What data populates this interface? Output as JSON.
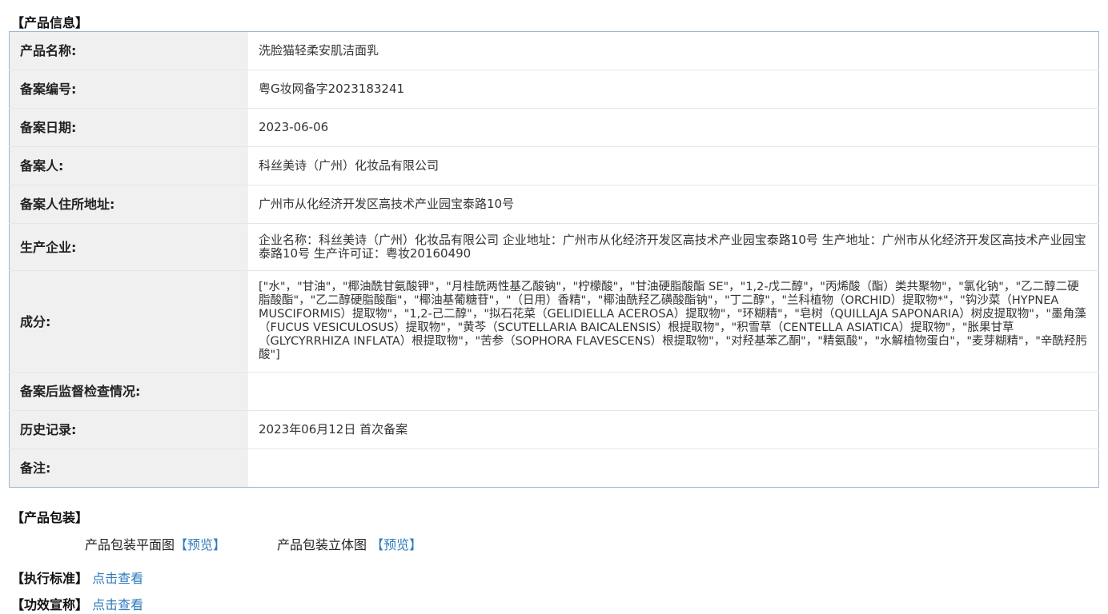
{
  "product_info": {
    "title": "【产品信息】",
    "rows": [
      {
        "label": "产品名称:",
        "value": "洗脸猫轻柔安肌洁面乳"
      },
      {
        "label": "备案编号:",
        "value": "粤G妆网备字2023183241"
      },
      {
        "label": "备案日期:",
        "value": "2023-06-06"
      },
      {
        "label": "备案人:",
        "value": "科丝美诗（广州）化妆品有限公司"
      },
      {
        "label": "备案人住所地址:",
        "value": "广州市从化经济开发区高技术产业园宝泰路10号"
      },
      {
        "label": "生产企业:",
        "value": "企业名称：科丝美诗（广州）化妆品有限公司 企业地址：广州市从化经济开发区高技术产业园宝泰路10号 生产地址：广州市从化经济开发区高技术产业园宝泰路10号 生产许可证：粤妆20160490"
      },
      {
        "label": "成分:",
        "value": "[\"水\"，\"甘油\"，\"椰油酰甘氨酸钾\"，\"月桂酰两性基乙酸钠\"，\"柠檬酸\"，\"甘油硬脂酸酯 SE\"，\"1,2-戊二醇\"，\"丙烯酸（酯）类共聚物\"，\"氯化钠\"，\"乙二醇二硬脂酸酯\"，\"乙二醇硬脂酸酯\"，\"椰油基葡糖苷\"，\"（日用）香精\"，\"椰油酰羟乙磺酸酯钠\"，\"丁二醇\"，\"兰科植物（ORCHID）提取物*\"，\"钩沙菜（HYPNEA MUSCIFORMIS）提取物\"，\"1,2-己二醇\"，\"拟石花菜（GELIDIELLA ACEROSA）提取物\"，\"环糊精\"，\"皂树（QUILLAJA SAPONARIA）树皮提取物\"，\"墨角藻（FUCUS VESICULOSUS）提取物\"，\"黄芩（SCUTELLARIA BAICALENSIS）根提取物\"，\"积雪草（CENTELLA ASIATICA）提取物\"，\"胀果甘草（GLYCYRRHIZA INFLATA）根提取物\"，\"苦参（SOPHORA FLAVESCENS）根提取物\"，\"对羟基苯乙酮\"，\"精氨酸\"，\"水解植物蛋白\"，\"麦芽糊精\"，\"辛酰羟肟酸\"]"
      },
      {
        "label": "备案后监督检查情况:",
        "value": ""
      },
      {
        "label": "历史记录:",
        "value": "2023年06月12日 首次备案"
      },
      {
        "label": "备注:",
        "value": ""
      }
    ]
  },
  "packaging": {
    "title": "【产品包装】",
    "flat_label": "产品包装平面图",
    "flat_link": "【预览】",
    "stereo_label": "产品包装立体图 ",
    "stereo_link": "【预览】"
  },
  "standard": {
    "label": "【执行标准】",
    "link": "点击查看"
  },
  "efficacy": {
    "label": "【功效宣称】",
    "link": "点击查看"
  }
}
